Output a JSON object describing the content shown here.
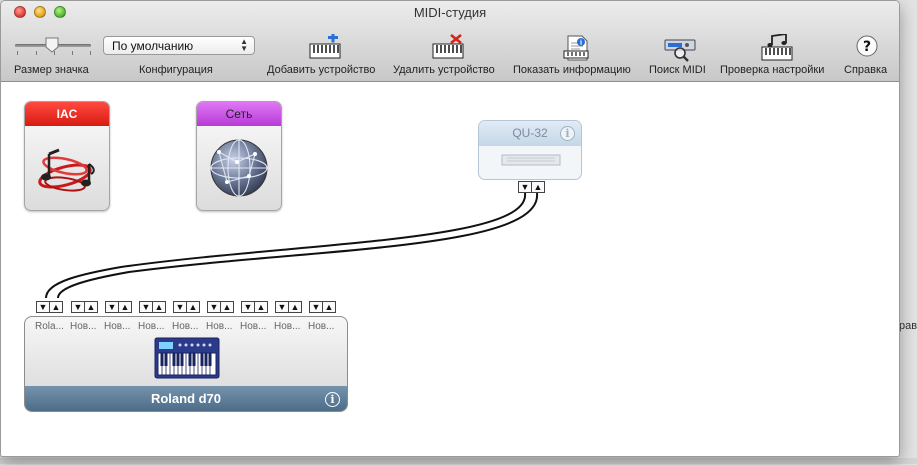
{
  "window": {
    "title": "MIDI-студия"
  },
  "toolbar": {
    "icon_size_label": "Размер значка",
    "config_label": "Конфигурация",
    "config_value": "По умолчанию",
    "add_device": "Добавить устройство",
    "remove_device": "Удалить устройство",
    "show_info": "Показать информацию",
    "search_midi": "Поиск MIDI",
    "test_setup": "Проверка настройки",
    "help": "Справка"
  },
  "devices": {
    "iac": {
      "name": "IAC"
    },
    "network": {
      "name": "Сеть"
    },
    "qu32": {
      "name": "QU-32"
    },
    "roland": {
      "name": "Roland d70",
      "ports": [
        "Rola...",
        "Нов...",
        "Нов...",
        "Нов...",
        "Нов...",
        "Нов...",
        "Нов...",
        "Нов...",
        "Нов..."
      ]
    }
  },
  "glyphs": {
    "port_out": "▼",
    "port_in": "▲",
    "info": "i"
  },
  "background": {
    "text_right": "рав"
  },
  "colors": {
    "iac_band": "#e2231a",
    "network_band": "#c556e8",
    "roland_footer": "#5a7a96"
  }
}
